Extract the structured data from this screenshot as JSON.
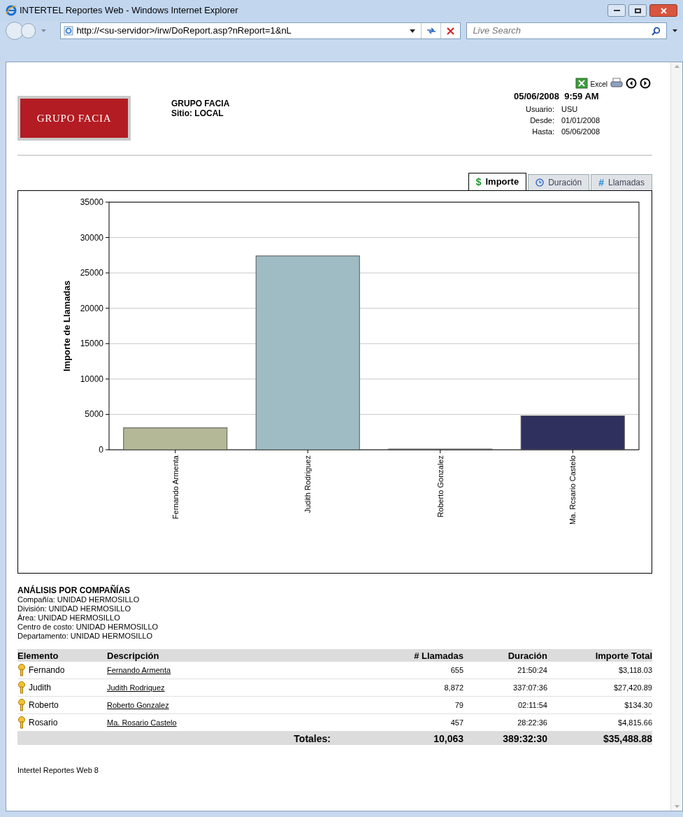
{
  "window": {
    "title": "INTERTEL Reportes Web - Windows Internet Explorer"
  },
  "address_bar": {
    "url": "http://<su-servidor>/irw/DoReport.asp?nReport=1&nL",
    "search_placeholder": "Live Search"
  },
  "header": {
    "logo_text": "GRUPO FACIA",
    "company": "GRUPO FACIA",
    "site": "Sitio: LOCAL",
    "excel_label": "Excel",
    "datetime": "05/06/2008  9:59 AM",
    "meta": [
      {
        "label": "Usuario:",
        "value": "USU"
      },
      {
        "label": "Desde:",
        "value": "01/01/2008"
      },
      {
        "label": "Hasta:",
        "value": "05/06/2008"
      }
    ]
  },
  "tabs": [
    {
      "kind": "dollar",
      "icon": "$",
      "label": "Importe",
      "selected": true
    },
    {
      "kind": "clock",
      "label": "Duración",
      "selected": false
    },
    {
      "kind": "hash",
      "icon": "#",
      "label": "Llamadas",
      "selected": false
    }
  ],
  "chart_data": {
    "type": "bar",
    "ylabel": "Importe de Llamadas",
    "categories": [
      "Fernando Armenta",
      "Judith Rodriguez",
      "Roberto Gonzalez",
      "Ma. Rcsario Castelo"
    ],
    "colors": [
      "#b4b896",
      "#9fbcc4",
      "#f2f2f2",
      "#30305e"
    ],
    "series": [
      {
        "values": [
          3100,
          27400,
          100,
          4800
        ]
      }
    ],
    "grid": true,
    "ylim": [
      0,
      35000
    ],
    "yticks": [
      0,
      5000,
      10000,
      15000,
      20000,
      25000,
      30000,
      35000
    ]
  },
  "analysis": {
    "title": "ANÁLISIS POR COMPAÑÍAS",
    "lines": [
      "Compañía: UNIDAD HERMOSILLO",
      "División: UNIDAD HERMOSILLO",
      "Área: UNIDAD HERMOSILLO",
      "Centro de costo: UNIDAD HERMOSILLO",
      "Departamento: UNIDAD HERMOSILLO"
    ]
  },
  "table": {
    "columns": [
      "Elemento",
      "Descripción",
      "# Llamadas",
      "Duración",
      "Importe Total"
    ],
    "rows": [
      {
        "element": "Fernando",
        "description": "Fernando Armenta",
        "calls": "655",
        "duration": "21:50:24",
        "amount": "$3,118.03"
      },
      {
        "element": "Judith",
        "description": "Judith Rodriquez",
        "calls": "8,872",
        "duration": "337:07:36",
        "amount": "$27,420.89"
      },
      {
        "element": "Roberto",
        "description": "Roberto Gonzalez",
        "calls": "79",
        "duration": "02:11:54",
        "amount": "$134.30"
      },
      {
        "element": "Rosario",
        "description": "Ma. Rosario Castelo",
        "calls": "457",
        "duration": "28:22:36",
        "amount": "$4,815.66"
      }
    ],
    "totals": {
      "label": "Totales:",
      "calls": "10,063",
      "duration": "389:32:30",
      "amount": "$35,488.88"
    }
  },
  "footer": "Intertel Reportes Web 8"
}
